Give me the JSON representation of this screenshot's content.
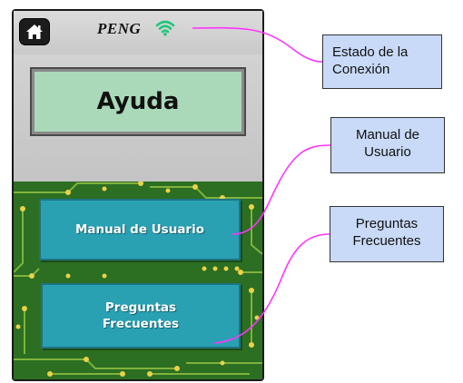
{
  "app": {
    "brand": "PENG",
    "screen_title": "Ayuda"
  },
  "menu": {
    "manual": "Manual de Usuario",
    "faq": "Preguntas\nFrecuentes"
  },
  "callouts": {
    "estado": [
      "Estado de la",
      "Conexión"
    ],
    "manual": [
      "Manual de",
      "Usuario"
    ],
    "faq": [
      "Preguntas",
      "Frecuentes"
    ]
  },
  "icons": {
    "home": "home-icon",
    "wifi": "wifi-icon"
  },
  "colors": {
    "wifi": "#21c77a",
    "leader_line": "#ff33ff",
    "callout_bg": "#c9daf8",
    "button_bg": "#2aa0b3",
    "lcd_bg": "#a9d9b9",
    "circuit_bg": "#2c6e22"
  }
}
